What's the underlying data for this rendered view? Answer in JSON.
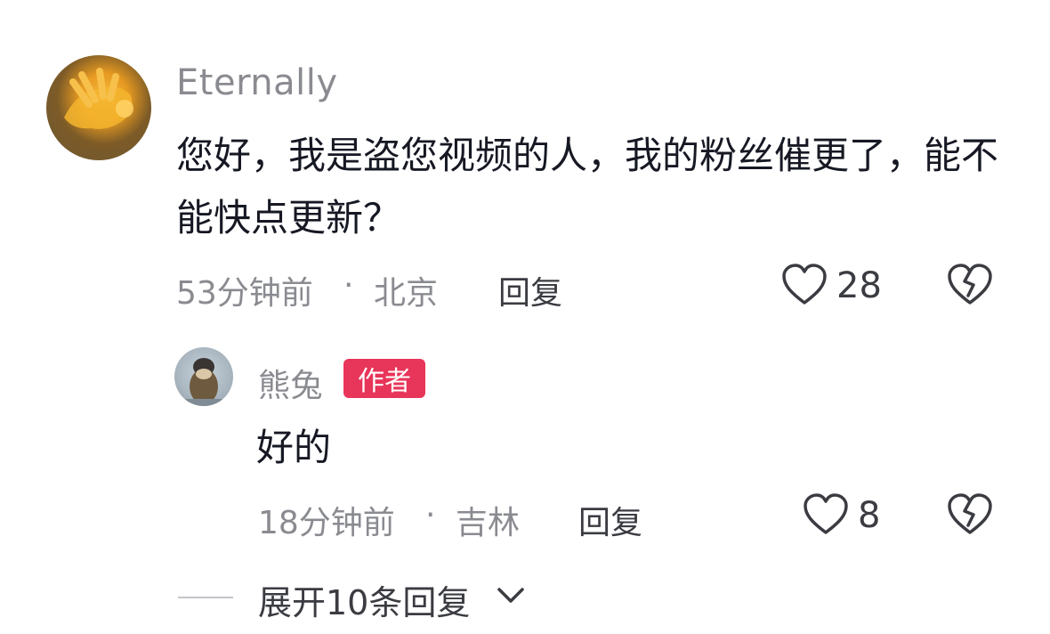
{
  "comment": {
    "username": "Eternally",
    "text": "您好，我是盗您视频的人，我的粉丝催更了，能不能快点更新？",
    "time": "53分钟前",
    "separator": "·",
    "location": "北京",
    "reply_label": "回复",
    "like_count": "28"
  },
  "reply": {
    "username": "熊兔",
    "badge": "作者",
    "text": "好的",
    "time": "18分钟前",
    "separator": "·",
    "location": "吉林",
    "reply_label": "回复",
    "like_count": "8"
  },
  "expand": {
    "label": "展开10条回复"
  },
  "colors": {
    "badge_bg": "#e8355a",
    "meta_text": "#8a8b91",
    "body_text": "#161823"
  },
  "icons": {
    "like": "heart-outline-icon",
    "dislike": "broken-heart-icon",
    "expand": "chevron-down-icon"
  }
}
